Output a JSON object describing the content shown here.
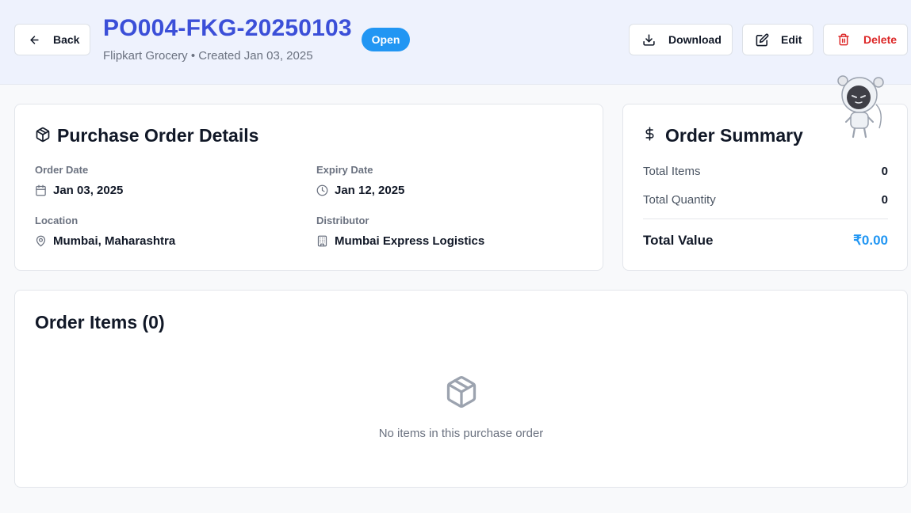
{
  "header": {
    "back_label": "Back",
    "po_number": "PO004-FKG-20250103",
    "status": "Open",
    "subtitle": "Flipkart Grocery • Created Jan 03, 2025",
    "download_label": "Download",
    "edit_label": "Edit",
    "delete_label": "Delete"
  },
  "details": {
    "title": "Purchase Order Details",
    "order_date_label": "Order Date",
    "order_date": "Jan 03, 2025",
    "expiry_date_label": "Expiry Date",
    "expiry_date": "Jan 12, 2025",
    "location_label": "Location",
    "location": "Mumbai, Maharashtra",
    "distributor_label": "Distributor",
    "distributor": "Mumbai Express Logistics"
  },
  "summary": {
    "title": "Order Summary",
    "total_items_label": "Total Items",
    "total_items": "0",
    "total_quantity_label": "Total Quantity",
    "total_quantity": "0",
    "total_value_label": "Total Value",
    "total_value": "₹0.00"
  },
  "items": {
    "title": "Order Items (0)",
    "empty_message": "No items in this purchase order"
  },
  "colors": {
    "accent": "#3b4fd8",
    "status_badge": "#2196f3",
    "delete": "#dc2626"
  },
  "icons": [
    "arrow-left-icon",
    "download-icon",
    "edit-icon",
    "trash-icon",
    "package-icon",
    "dollar-icon",
    "calendar-icon",
    "clock-icon",
    "map-pin-icon",
    "building-icon",
    "mascot-robot-icon"
  ]
}
